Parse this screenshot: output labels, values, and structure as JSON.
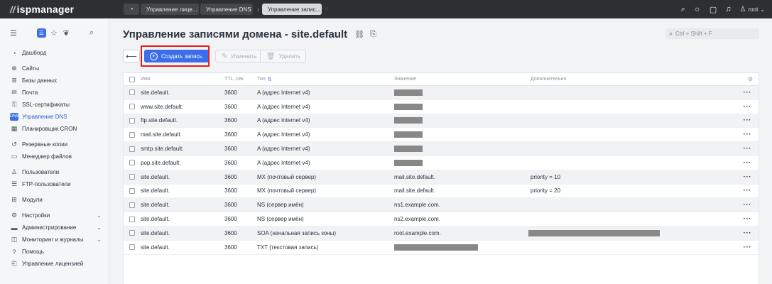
{
  "app": {
    "logo_mark": "//",
    "logo_text": "ispmanager"
  },
  "tabs": {
    "home_icon": "dashboard-icon",
    "items": [
      {
        "label": "Управление лице..."
      },
      {
        "label": "Управление DNS"
      },
      {
        "label": "Управление запис..."
      }
    ],
    "separator": "›",
    "close": "✕"
  },
  "topbar": {
    "user": "root"
  },
  "sidebar": {
    "items": [
      {
        "label": "Дашборд",
        "icon": "◔"
      },
      {
        "label": "Сайты",
        "icon": "⊕"
      },
      {
        "label": "Базы данных",
        "icon": "≣"
      },
      {
        "label": "Почта",
        "icon": "✉"
      },
      {
        "label": "SSL-сертификаты",
        "icon": "⚿"
      },
      {
        "label": "Управление DNS",
        "icon": "DNS"
      },
      {
        "label": "Планировщик CRON",
        "icon": "▦"
      },
      {
        "label": "Резервные копии",
        "icon": "↺"
      },
      {
        "label": "Менеджер файлов",
        "icon": "▭"
      },
      {
        "label": "Пользователи",
        "icon": "♙"
      },
      {
        "label": "FTP-пользователи",
        "icon": "☰"
      },
      {
        "label": "Модули",
        "icon": "⊞"
      },
      {
        "label": "Настройки",
        "icon": "⚙"
      },
      {
        "label": "Администрирование",
        "icon": "▬"
      },
      {
        "label": "Мониторинг и журналы",
        "icon": "◫"
      },
      {
        "label": "Помощь",
        "icon": "?"
      },
      {
        "label": "Управление лицензией",
        "icon": "⎗"
      }
    ]
  },
  "page": {
    "title": "Управление записями домена - site.default",
    "search_placeholder": "Ctrl + Shift + F"
  },
  "toolbar": {
    "back": "⟵",
    "create": "Создать запись",
    "edit": "Изменить",
    "delete": "Удалить"
  },
  "table": {
    "columns": {
      "name": "Имя",
      "ttl": "TTL, сек",
      "type": "Тип",
      "value": "Значение",
      "extra": "Дополнительно"
    },
    "rows": [
      {
        "name": "site.default.",
        "ttl": "3600",
        "type": "A (адрес Internet v4)",
        "value": "",
        "extra": ""
      },
      {
        "name": "www.site.default.",
        "ttl": "3600",
        "type": "A (адрес Internet v4)",
        "value": "",
        "extra": ""
      },
      {
        "name": "ftp.site.default.",
        "ttl": "3600",
        "type": "A (адрес Internet v4)",
        "value": "",
        "extra": ""
      },
      {
        "name": "mail.site.default.",
        "ttl": "3600",
        "type": "A (адрес Internet v4)",
        "value": "",
        "extra": ""
      },
      {
        "name": "smtp.site.default.",
        "ttl": "3600",
        "type": "A (адрес Internet v4)",
        "value": "",
        "extra": ""
      },
      {
        "name": "pop.site.default.",
        "ttl": "3600",
        "type": "A (адрес Internet v4)",
        "value": "",
        "extra": ""
      },
      {
        "name": "site.default.",
        "ttl": "3600",
        "type": "MX (почтовый сервер)",
        "value": "mail.site.default.",
        "extra": "priority = 10"
      },
      {
        "name": "site.default.",
        "ttl": "3600",
        "type": "MX (почтовый сервер)",
        "value": "mail.site.default.",
        "extra": "priority = 20"
      },
      {
        "name": "site.default.",
        "ttl": "3600",
        "type": "NS (сервер имён)",
        "value": "ns1.example.com.",
        "extra": ""
      },
      {
        "name": "site.default.",
        "ttl": "3600",
        "type": "NS (сервер имён)",
        "value": "ns2.example.com.",
        "extra": ""
      },
      {
        "name": "site.default.",
        "ttl": "3600",
        "type": "SOA (начальная запись зоны)",
        "value": "root.example.com.",
        "extra": ""
      },
      {
        "name": "site.default.",
        "ttl": "3600",
        "type": "TXT (текстовая запись)",
        "value": "",
        "extra": ""
      }
    ]
  },
  "colors": {
    "accent": "#3b6ee8",
    "highlight": "#e41b1b",
    "topbar": "#2d2f33"
  }
}
